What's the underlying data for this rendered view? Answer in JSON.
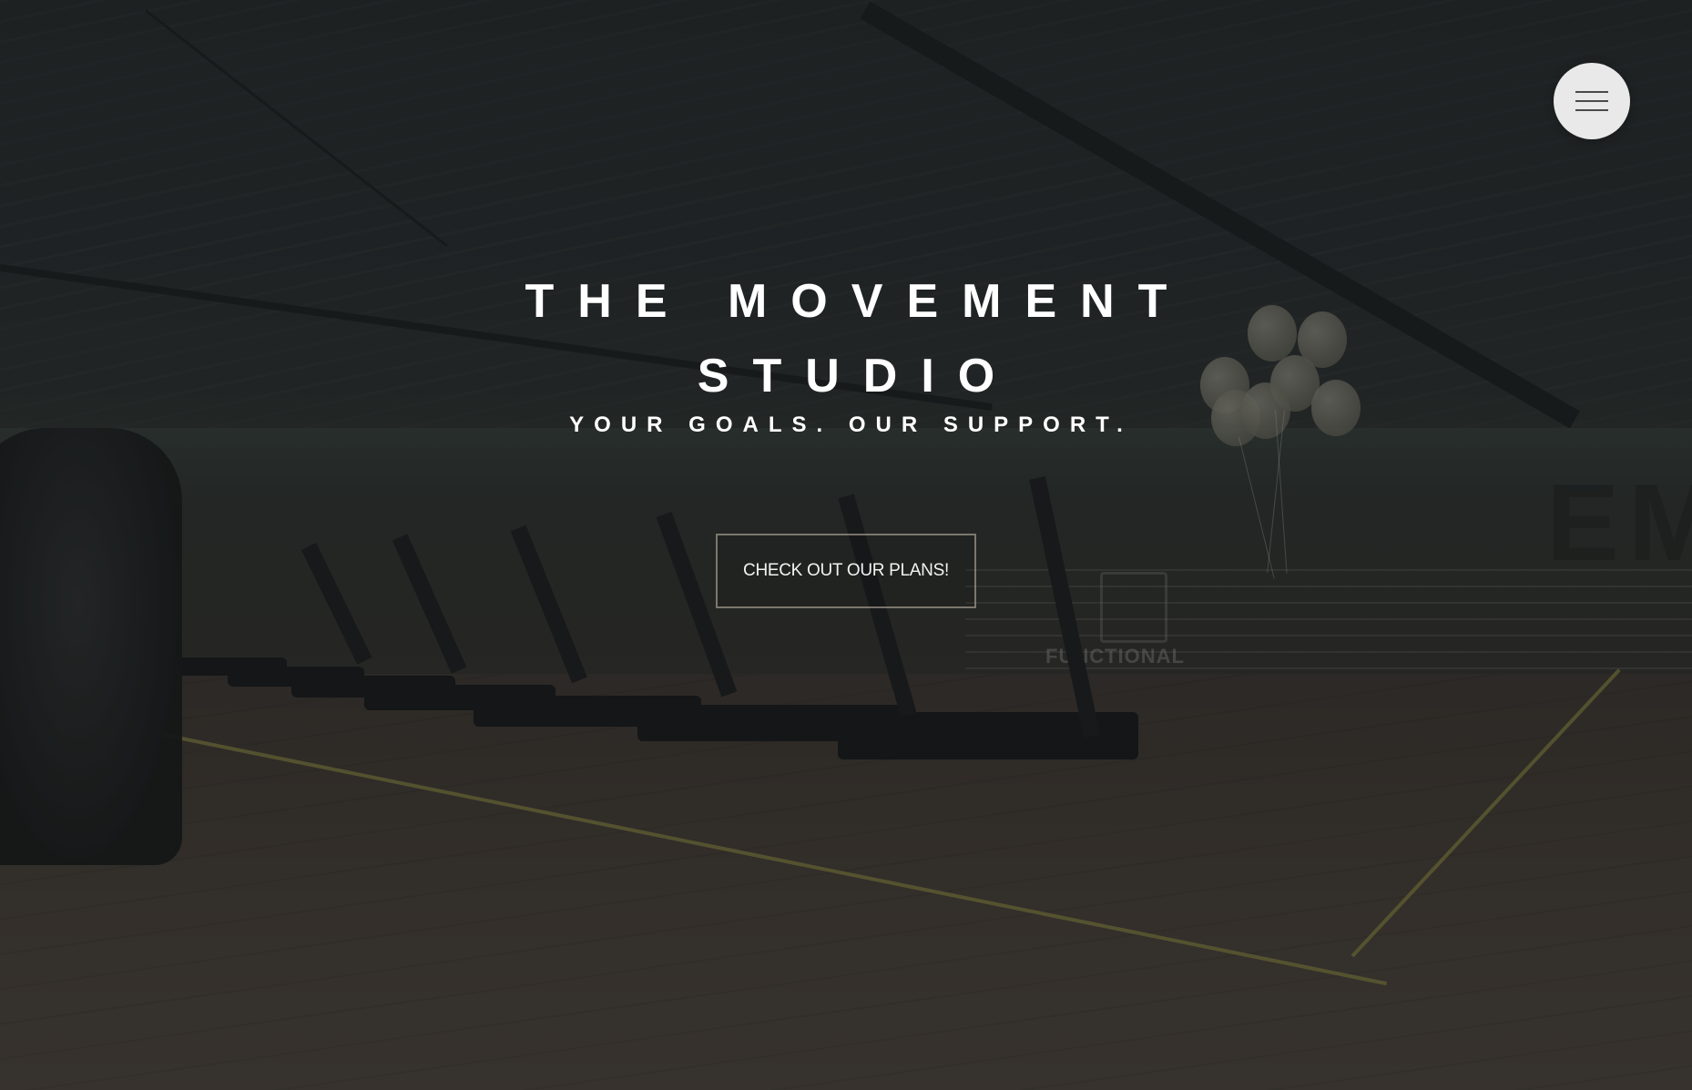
{
  "hero": {
    "title_line1": "THE MOVEMENT",
    "title_line2": "STUDIO",
    "tagline": "YOUR GOALS. OUR SUPPORT.",
    "cta_label": "CHECK OUT OUR PLANS!"
  },
  "menu": {
    "icon": "hamburger-menu-icon"
  },
  "colors": {
    "menu_button_bg": "#e9e9e9",
    "text": "#ffffff",
    "cta_border": "#c8beaf"
  }
}
